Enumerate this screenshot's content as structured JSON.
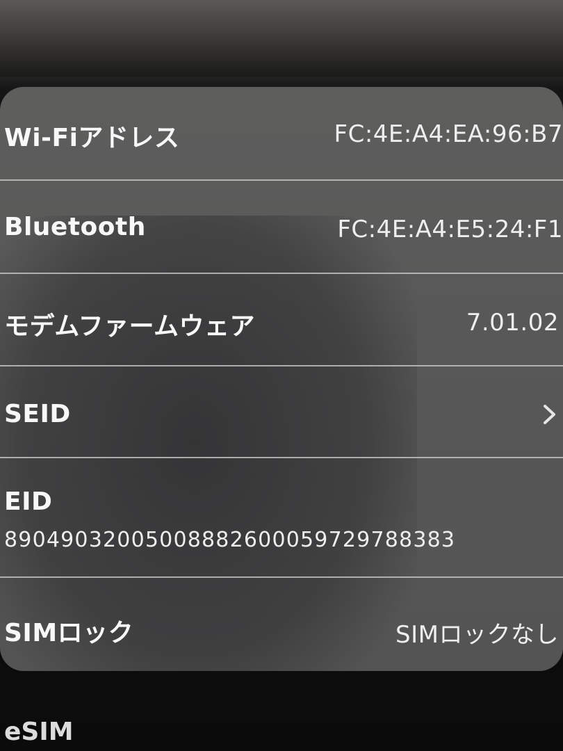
{
  "rows": {
    "wifi": {
      "label": "Wi-Fiアドレス",
      "value": "FC:4E:A4:EA:96:B7"
    },
    "bluetooth": {
      "label": "Bluetooth",
      "value": "FC:4E:A4:E5:24:F1"
    },
    "modem": {
      "label": "モデムファームウェア",
      "value": "7.01.02"
    },
    "seid": {
      "label": "SEID",
      "icon": "chevron-right-icon"
    },
    "eid": {
      "label": "EID",
      "value": "89049032005008882600059729788383"
    },
    "simlock": {
      "label": "SIMロック",
      "value": "SIMロックなし"
    }
  },
  "footer": {
    "section_label": "eSIM"
  },
  "colors": {
    "card_background": "#585858",
    "divider": "#c9c9c9",
    "text": "#ffffff",
    "screen_background": "#0b0b0b"
  }
}
